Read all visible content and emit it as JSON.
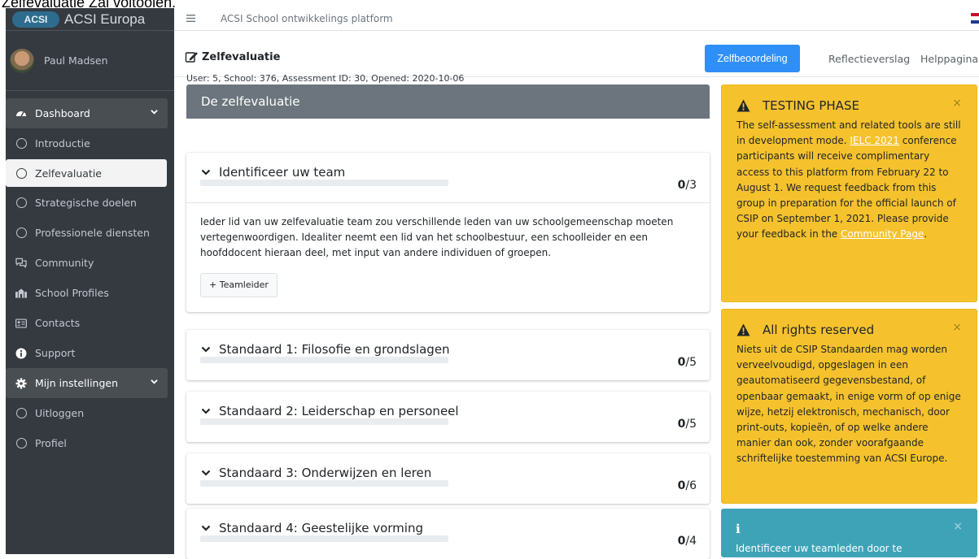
{
  "caption": "Zelfevaluatie Zal voltooien.",
  "brand": {
    "logo_text": "ACSI",
    "name": "ACSI Europa"
  },
  "user": {
    "name": "Paul Madsen"
  },
  "nav": [
    {
      "label": "Dashboard",
      "type": "group",
      "icon": "dashboard-icon"
    },
    {
      "label": "Introductie",
      "type": "item",
      "icon": "circle-icon"
    },
    {
      "label": "Zelfevaluatie",
      "type": "item",
      "icon": "circle-icon",
      "active": true
    },
    {
      "label": "Strategische doelen",
      "type": "item",
      "icon": "circle-icon"
    },
    {
      "label": "Professionele diensten",
      "type": "item",
      "icon": "circle-icon"
    },
    {
      "label": "Community",
      "type": "item",
      "icon": "community-icon"
    },
    {
      "label": "School Profiles",
      "type": "item",
      "icon": "school-profiles-icon"
    },
    {
      "label": "Contacts",
      "type": "item",
      "icon": "contacts-icon"
    },
    {
      "label": "Support",
      "type": "item",
      "icon": "info-icon"
    },
    {
      "label": "Mijn instellingen",
      "type": "group",
      "icon": "gear-icon"
    },
    {
      "label": "Uitloggen",
      "type": "item",
      "icon": "circle-icon"
    },
    {
      "label": "Profiel",
      "type": "item",
      "icon": "circle-icon"
    }
  ],
  "topbar": {
    "title": "ACSI School ontwikkelings platform"
  },
  "header": {
    "title": "Zelfevaluatie",
    "primary_button": "Zelfbeoordeling",
    "link1": "Reflectieverslag",
    "link2": "Helppagina"
  },
  "meta": "User: 5, School: 376, Assessment ID: 30, Opened: 2020-10-06",
  "section_title": "De zelfevaluatie",
  "cards": [
    {
      "title": "Identificeer uw team",
      "score": "0",
      "total": "/3",
      "progress": 0,
      "body": "Ieder lid van uw zelfevaluatie team zou verschillende leden van uw schoolgemeenschap moeten vertegenwoordigen. Idealiter neemt een lid van het schoolbestuur, een schoolleider en een hoofddocent hieraan deel, met input van andere individuen of groepen.",
      "button": "+ Teamleider"
    },
    {
      "title": "Standaard 1: Filosofie en grondslagen",
      "score": "0",
      "total": "/5",
      "progress": 0
    },
    {
      "title": "Standaard 2: Leiderschap en personeel",
      "score": "0",
      "total": "/5",
      "progress": 0
    },
    {
      "title": "Standaard 3: Onderwijzen en leren",
      "score": "0",
      "total": "/6",
      "progress": 0
    },
    {
      "title": "Standaard 4: Geestelijke vorming",
      "score": "0",
      "total": "/4",
      "progress": 0
    }
  ],
  "alerts": [
    {
      "title": "TESTING PHASE",
      "text_a": "The self-assessment and related tools are still in development mode. ",
      "link_a": "IELC 2021",
      "text_b": " conference participants will receive complimentary access to this platform from February 22 to August 1. We request feedback from this group in preparation for the official launch of CSIP on September 1, 2021. Please provide your feedback in the ",
      "link_b": "Community Page",
      "text_c": "."
    },
    {
      "title": "All rights reserved",
      "text": "Niets uit de CSIP Standaarden mag worden verveelvoudigd, opgeslagen in een geautomatiseerd gegevensbestand, of openbaar gemaakt, in enige vorm of op enige wijze, hetzij elektronisch, mechanisch, door print-outs, kopieën, of op welke andere manier dan ook, zonder voorafgaande schriftelijke toestemming van ACSI Europe."
    },
    {
      "title": "i",
      "text": "Identificeer uw teamleden door te"
    }
  ],
  "colors": {
    "sidebar": "#343a40",
    "primary": "#2f8ff7",
    "warning": "#f5c22d",
    "info": "#3fa3b8",
    "section": "#6c757d"
  }
}
